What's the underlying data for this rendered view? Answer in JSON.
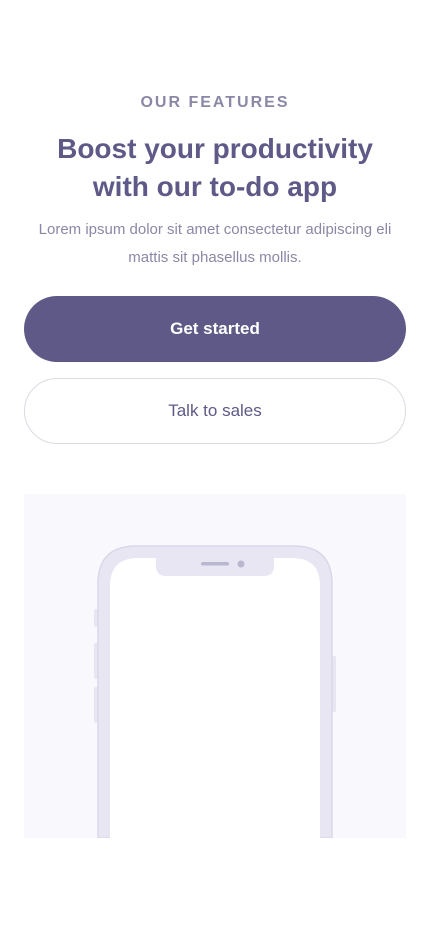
{
  "features": {
    "eyebrow": "OUR FEATURES",
    "title": "Boost your productivity with our to-do app",
    "subtitle": "Lorem ipsum dolor sit amet consectetur adipiscing eli mattis sit phasellus mollis."
  },
  "actions": {
    "primary_label": "Get started",
    "secondary_label": "Talk to sales"
  },
  "colors": {
    "brand": "#5e5986",
    "muted_text": "#8b88a6",
    "phone_frame": "#e8e6f3",
    "preview_bg": "#f8f8fd"
  },
  "icons": {
    "preview": "phone-mockup-icon"
  }
}
